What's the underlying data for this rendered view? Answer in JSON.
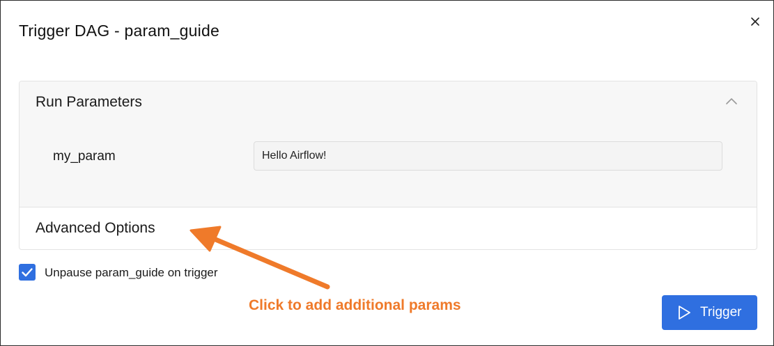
{
  "dialog": {
    "title": "Trigger DAG - param_guide",
    "close_icon": "close-icon"
  },
  "run_parameters": {
    "header": "Run Parameters",
    "expanded": true,
    "toggle_icon": "chevron-up-icon",
    "params": [
      {
        "name": "my_param",
        "value": "Hello Airflow!"
      }
    ]
  },
  "advanced_options": {
    "header": "Advanced Options"
  },
  "unpause": {
    "checked": true,
    "label": "Unpause param_guide on trigger"
  },
  "annotation": {
    "text": "Click to add additional params",
    "color": "#ef7a2a"
  },
  "trigger_button": {
    "label": "Trigger",
    "icon": "play-icon",
    "color": "#2f6fe0"
  }
}
